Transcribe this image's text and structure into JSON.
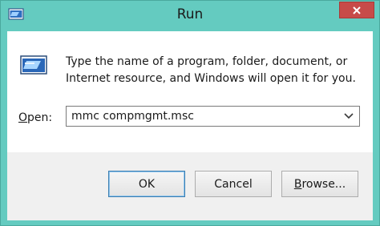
{
  "window": {
    "title": "Run"
  },
  "dialog": {
    "description": "Type the name of a program, folder, document, or Internet resource, and Windows will open it for you.",
    "open_label_hotkey": "O",
    "open_label_rest": "pen:",
    "open_value": "mmc compmgmt.msc"
  },
  "buttons": {
    "ok": "OK",
    "cancel": "Cancel",
    "browse_hotkey": "B",
    "browse_rest": "rowse..."
  },
  "icons": {
    "app": "run-icon",
    "close": "close-icon",
    "dropdown": "chevron-down-icon"
  },
  "colors": {
    "frame": "#64cbc0",
    "close_button": "#c74b49",
    "default_button_border": "#3c7fb1"
  }
}
